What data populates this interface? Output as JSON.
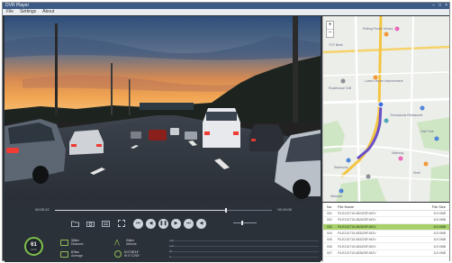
{
  "window": {
    "title": "DVR Player",
    "controls": [
      "–",
      "□",
      "×"
    ]
  },
  "menu": {
    "items": [
      "File",
      "Settings",
      "About"
    ]
  },
  "playback": {
    "current_time": "00:05:12",
    "total_time": "00:10:00",
    "progress": 0.79,
    "volume": 0.35
  },
  "toolbar": {
    "icons": [
      "folder-icon",
      "camera-icon",
      "export-icon",
      "fullscreen-icon"
    ],
    "transport": [
      "previous-icon",
      "rewind-icon",
      "pause-icon",
      "fast-forward-icon",
      "next-icon",
      "volume-icon"
    ]
  },
  "telemetry": {
    "speed_value": "61",
    "speed_unit": "km/h",
    "stat1": {
      "value": "32km",
      "label": "Distance"
    },
    "stat2": {
      "value": "67km",
      "label": "Average"
    },
    "stat3": {
      "value": "24km",
      "label": "Altitude"
    },
    "stat4": {
      "value": "N 0°28'14\"",
      "label": "W 0°12'08\""
    }
  },
  "graph": {
    "ticks": [
      "180",
      "120",
      "60",
      "0"
    ]
  },
  "map": {
    "labels": [
      "Rolling Pointe Library",
      "TCF Bank",
      "Lowe's Home Improvement",
      "Roadhouse Grill",
      "Thompsons Restaurant",
      "Oak Park",
      "Safeway",
      "Starbucks",
      "Shell",
      "Walmart"
    ]
  },
  "files": {
    "headers": [
      "No.",
      "File Name",
      "File Size"
    ],
    "rows": [
      {
        "no": "001",
        "name": "FILE210715-082425F.MOV",
        "size": "119.0MB"
      },
      {
        "no": "002",
        "name": "FILE210715-082625F.MOV",
        "size": "119.0MB"
      },
      {
        "no": "003",
        "name": "FILE210715-082825F.MOV",
        "size": "119.0MB"
      },
      {
        "no": "004",
        "name": "FILE210715-083025F.MOV",
        "size": "119.0MB"
      },
      {
        "no": "005",
        "name": "FILE210715-083225F.MOV",
        "size": "119.0MB"
      },
      {
        "no": "006",
        "name": "FILE210715-083425F.MOV",
        "size": "119.0MB"
      },
      {
        "no": "007",
        "name": "FILE210715-083625F.MOV",
        "size": "119.0MB"
      }
    ],
    "selected_index": 2
  },
  "colors": {
    "accent": "#8fbd55",
    "selected_row": "#a8d06a",
    "route": "#6a4fc9"
  }
}
